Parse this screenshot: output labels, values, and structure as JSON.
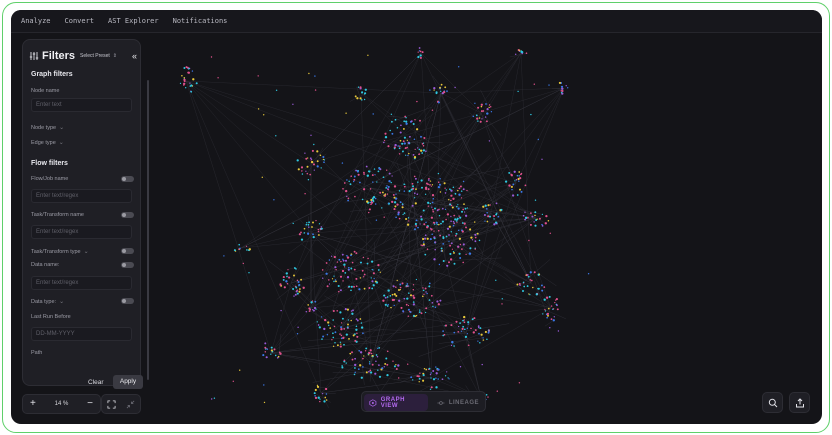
{
  "nav": {
    "items": [
      "Analyze",
      "Convert",
      "AST Explorer",
      "Notifications"
    ]
  },
  "filters": {
    "title": "Filters",
    "preset_label": "Select Preset",
    "preset_arrows": "⇕",
    "collapse_icon": "«",
    "graph_filters": {
      "title": "Graph filters",
      "node_name_label": "Node name",
      "node_name_placeholder": "Enter text",
      "node_type_label": "Node type",
      "edge_type_label": "Edge type"
    },
    "flow_filters": {
      "title": "Flow filters",
      "flow_job_label": "Flow/Job name",
      "flow_job_placeholder": "Enter text/regex",
      "task_transform_name_label": "Task/Transform name",
      "task_transform_name_placeholder": "Enter text/regex",
      "task_transform_type_label": "Task/Transform type",
      "data_name_label": "Data name:",
      "data_name_placeholder": "Enter text/regex",
      "data_type_label": "Data type:",
      "last_run_label": "Last Run Before",
      "last_run_placeholder": "DD-MM-YYYY",
      "path_label": "Path"
    },
    "clear_label": "Clear",
    "apply_label": "Apply"
  },
  "zoom": {
    "plus": "+",
    "value": "14 %",
    "minus": "−"
  },
  "view_toggle": {
    "graph_label": "GRAPH VIEW",
    "lineage_label": "LINEAGE"
  },
  "colors": {
    "accent": "#b46af0",
    "node_pink": "#e0508c",
    "node_cyan": "#2ec8e0",
    "node_blue": "#3a78e8",
    "node_yellow": "#e8c83a",
    "node_purple": "#9a5ad8"
  },
  "icons": [
    "sliders-icon",
    "chevron-down-icon",
    "fit-screen-icon",
    "collapse-arrows-icon",
    "graph-view-icon",
    "lineage-icon",
    "search-icon",
    "export-icon"
  ]
}
